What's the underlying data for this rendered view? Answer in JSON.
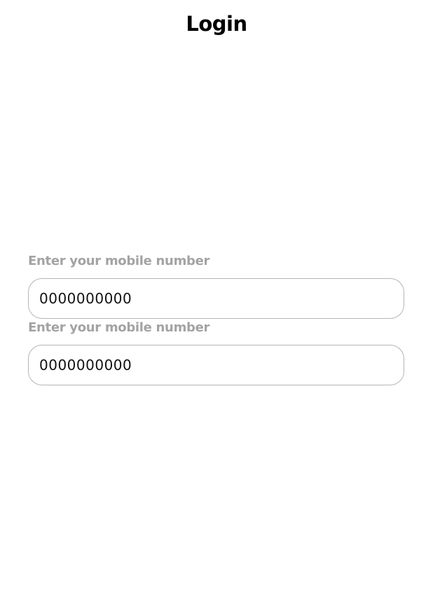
{
  "header": {
    "title": "Login"
  },
  "form": {
    "fields": [
      {
        "label": "Enter your mobile number",
        "value": "0000000000"
      },
      {
        "label": "Enter your mobile number",
        "value": "0000000000"
      }
    ]
  }
}
